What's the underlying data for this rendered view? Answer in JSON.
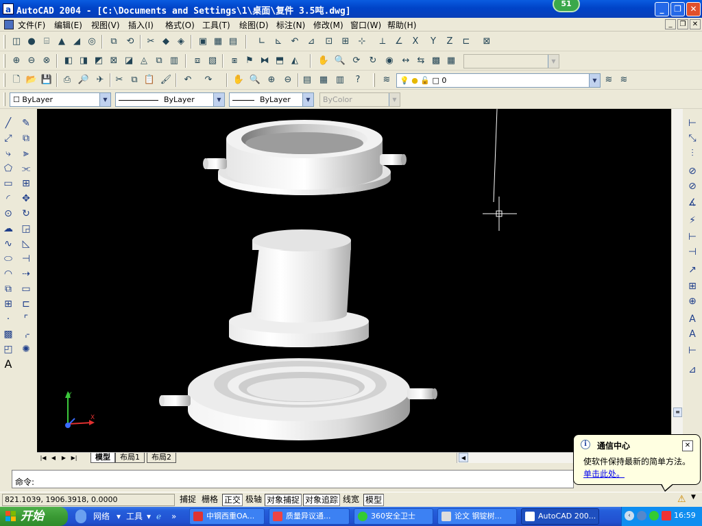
{
  "window": {
    "title": "AutoCAD 2004 - [C:\\Documents and Settings\\1\\桌面\\复件 3.5吨.dwg]",
    "app_icon": "a",
    "notification_count": "51",
    "minimize": "_",
    "restore": "❐",
    "close": "✕"
  },
  "menu": {
    "items": [
      "文件(F)",
      "编辑(E)",
      "视图(V)",
      "插入(I)",
      "格式(O)",
      "工具(T)",
      "绘图(D)",
      "标注(N)",
      "修改(M)",
      "窗口(W)",
      "帮助(H)"
    ]
  },
  "properties": {
    "color": "ByLayer",
    "linetype": "ByLayer",
    "lineweight": "ByLayer",
    "plotstyle": "ByColor"
  },
  "layer": {
    "current": "0"
  },
  "layout_tabs": [
    "模型",
    "布局1",
    "布局2"
  ],
  "ucs": {
    "x_label": "X",
    "y_label": "Y"
  },
  "command": {
    "prompt": "命令:"
  },
  "status": {
    "coords": "821.1039,  1906.3918,  0.0000",
    "toggles": [
      {
        "label": "捕捉",
        "on": false
      },
      {
        "label": "栅格",
        "on": false
      },
      {
        "label": "正交",
        "on": true
      },
      {
        "label": "极轴",
        "on": false
      },
      {
        "label": "对象捕捉",
        "on": true
      },
      {
        "label": "对象追踪",
        "on": true
      },
      {
        "label": "线宽",
        "on": false
      },
      {
        "label": "模型",
        "on": true
      }
    ]
  },
  "balloon": {
    "title": "通信中心",
    "message": "使软件保持最新的简单方法。",
    "link": "单击此处。",
    "close": "✕"
  },
  "taskbar": {
    "start": "开始",
    "quicklaunch": [
      "网络",
      "工具"
    ],
    "tasks": [
      {
        "label": "中钢西重OA..."
      },
      {
        "label": "质量异议通..."
      },
      {
        "label": "360安全卫士"
      },
      {
        "label": "论文 钢锭树..."
      },
      {
        "label": "AutoCAD 200..."
      }
    ],
    "clock": "16:59"
  },
  "colors": {
    "title_blue": "#0a5ce0",
    "viewport_bg": "#000000",
    "taskbar_blue": "#245edb",
    "start_green": "#3a9a34",
    "balloon_bg": "#ffffe1"
  }
}
